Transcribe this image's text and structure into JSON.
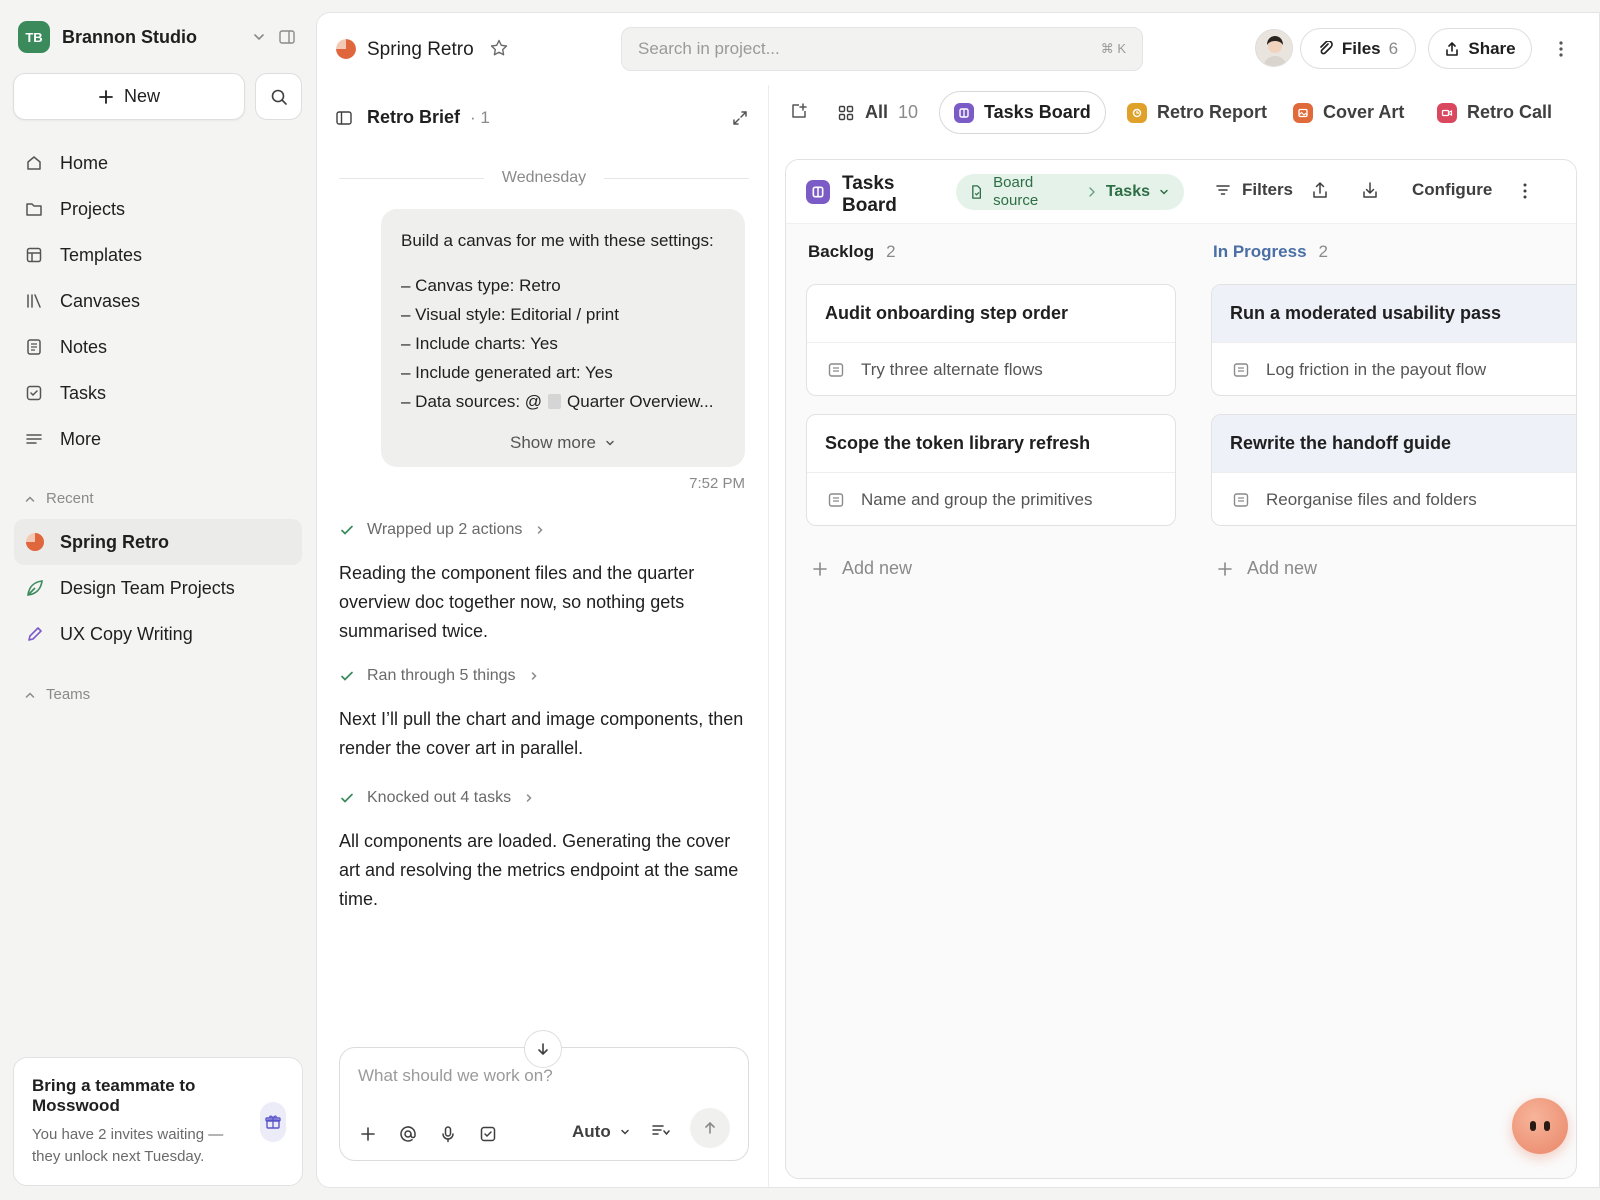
{
  "workspace": {
    "initials": "TB",
    "name": "Brannon Studio"
  },
  "sidebar": {
    "new_label": "New",
    "nav": [
      {
        "label": "Home",
        "icon": "home-icon"
      },
      {
        "label": "Projects",
        "icon": "folder-icon"
      },
      {
        "label": "Templates",
        "icon": "template-icon"
      },
      {
        "label": "Canvases",
        "icon": "canvas-icon"
      },
      {
        "label": "Notes",
        "icon": "note-icon"
      },
      {
        "label": "Tasks",
        "icon": "task-icon"
      },
      {
        "label": "More",
        "icon": "more-lines-icon"
      }
    ],
    "recent_label": "Recent",
    "recent": [
      {
        "label": "Spring Retro",
        "icon": "pie-icon",
        "active": true
      },
      {
        "label": "Design Team Projects",
        "icon": "leaf-icon",
        "active": false
      },
      {
        "label": "UX Copy Writing",
        "icon": "pencil-icon",
        "active": false
      }
    ],
    "teams_label": "Teams",
    "invite": {
      "title": "Bring a teammate to Mosswood",
      "subtitle": "You have 2 invites waiting — they unlock next Tuesday."
    }
  },
  "topbar": {
    "project_title": "Spring Retro",
    "search_placeholder": "Search in project...",
    "search_shortcut": "⌘ K",
    "files_label": "Files",
    "files_count": "6",
    "share_label": "Share"
  },
  "chat": {
    "title": "Retro Brief",
    "count": "· 1",
    "day": "Wednesday",
    "prompt": {
      "heading": "Build a canvas for me with these settings:",
      "lines": [
        "– Canvas type: Retro",
        "– Visual style: Editorial / print",
        "– Include charts: Yes",
        "– Include generated art: Yes"
      ],
      "data_sources_prefix": "– Data sources: @",
      "data_sources_doc": "Quarter Overview...",
      "show_more": "Show more",
      "time": "7:52 PM"
    },
    "actions": [
      "Wrapped up 2 actions",
      "Ran through 5 things",
      "Knocked out 4 tasks"
    ],
    "messages": [
      "Reading the component files and the quarter overview doc together now, so nothing gets summarised twice.",
      "Next I’ll pull the chart and image components, then render the cover art in parallel.",
      "All components are loaded. Generating the cover art and resolving the metrics endpoint at the same time."
    ],
    "composer_placeholder": "What should we work on?",
    "mode_label": "Auto"
  },
  "canvas_tabs": {
    "all_label": "All",
    "all_count": "10",
    "tabs": [
      {
        "label": "Tasks Board",
        "color": "#7b5cc7",
        "active": true
      },
      {
        "label": "Retro Report",
        "color": "#e0a12a",
        "active": false
      },
      {
        "label": "Cover Art",
        "color": "#e06a3a",
        "active": false
      },
      {
        "label": "Retro Call",
        "color": "#d9485f",
        "active": false
      }
    ]
  },
  "board": {
    "title": "Tasks Board",
    "source_label": "Board source",
    "source_target": "Tasks",
    "filters_label": "Filters",
    "configure_label": "Configure",
    "add_new_label": "Add new",
    "columns": [
      {
        "name": "Backlog",
        "count": "2",
        "color": "#3f3f3f",
        "cards": [
          {
            "title": "Audit onboarding step order",
            "sub": "Try three alternate flows"
          },
          {
            "title": "Scope the token library refresh",
            "sub": "Name and group the primitives"
          }
        ]
      },
      {
        "name": "In Progress",
        "count": "2",
        "color": "#4a6fa5",
        "cards": [
          {
            "title": "Run a moderated usability pass",
            "sub": "Log friction in the payout flow"
          },
          {
            "title": "Rewrite the handoff guide",
            "sub": "Reorganise files and folders"
          }
        ]
      }
    ]
  }
}
